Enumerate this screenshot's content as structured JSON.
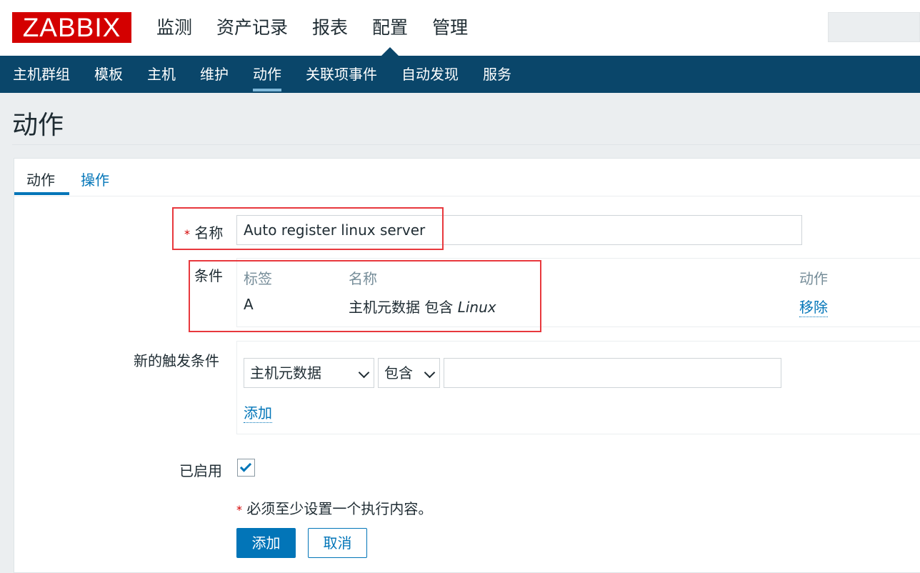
{
  "app": {
    "logo_text": "ZABBIX"
  },
  "main_menu": [
    {
      "label": "监测"
    },
    {
      "label": "资产记录"
    },
    {
      "label": "报表"
    },
    {
      "label": "配置",
      "active": true
    },
    {
      "label": "管理"
    }
  ],
  "sub_menu": [
    {
      "label": "主机群组"
    },
    {
      "label": "模板"
    },
    {
      "label": "主机"
    },
    {
      "label": "维护"
    },
    {
      "label": "动作",
      "active": true
    },
    {
      "label": "关联项事件"
    },
    {
      "label": "自动发现"
    },
    {
      "label": "服务"
    }
  ],
  "page": {
    "title": "动作"
  },
  "tabs": [
    {
      "label": "动作",
      "active": true
    },
    {
      "label": "操作"
    }
  ],
  "form": {
    "name_label": "名称",
    "required_mark": "*",
    "name_value": "Auto register linux server",
    "conditions_label": "条件",
    "conditions_table": {
      "headers": {
        "tag": "标签",
        "name": "名称",
        "action": "动作"
      },
      "rows": [
        {
          "tag": "A",
          "name_prefix": "主机元数据 包含",
          "name_value": "Linux",
          "action": "移除"
        }
      ]
    },
    "new_condition_label": "新的触发条件",
    "new_condition": {
      "type_selected": "主机元数据",
      "operator_selected": "包含",
      "value": "",
      "add_link": "添加"
    },
    "enabled_label": "已启用",
    "enabled": true,
    "note_mark": "*",
    "note_text": "必须至少设置一个执行内容。",
    "add_button": "添加",
    "cancel_button": "取消"
  },
  "colors": {
    "accent": "#0275b8",
    "header_dark": "#0a466a",
    "logo_red": "#d40000",
    "highlight_red": "#e8383d"
  }
}
